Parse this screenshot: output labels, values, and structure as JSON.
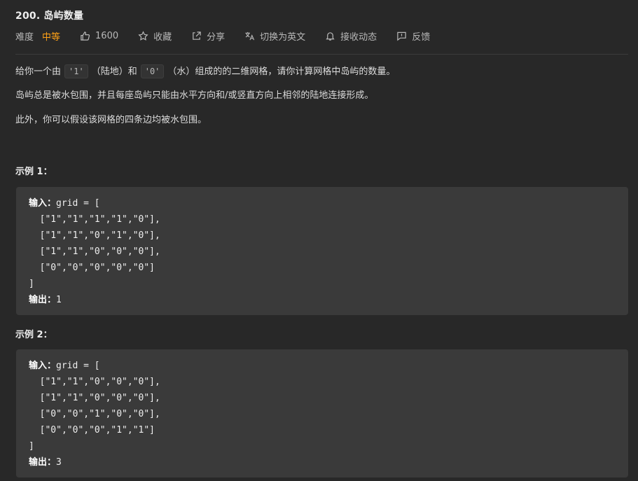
{
  "problem": {
    "title": "200. 岛屿数量",
    "difficulty_label": "难度",
    "difficulty_value": "中等",
    "likes": "1600",
    "favorite_label": "收藏",
    "share_label": "分享",
    "switch_lang_label": "切换为英文",
    "subscribe_label": "接收动态",
    "feedback_label": "反馈"
  },
  "description": {
    "p1_a": "给你一个由",
    "p1_code1": "'1'",
    "p1_b": "（陆地）和",
    "p1_code2": "'0'",
    "p1_c": "（水）组成的的二维网格，请你计算网格中岛屿的数量。",
    "p2": "岛屿总是被水包围，并且每座岛屿只能由水平方向和/或竖直方向上相邻的陆地连接形成。",
    "p3": "此外，你可以假设该网格的四条边均被水包围。"
  },
  "examples": [
    {
      "heading": "示例 1：",
      "input_label": "输入：",
      "input_first": "grid = [",
      "rows": [
        "  [\"1\",\"1\",\"1\",\"1\",\"0\"],",
        "  [\"1\",\"1\",\"0\",\"1\",\"0\"],",
        "  [\"1\",\"1\",\"0\",\"0\",\"0\"],",
        "  [\"0\",\"0\",\"0\",\"0\",\"0\"]"
      ],
      "input_close": "]",
      "output_label": "输出：",
      "output_value": "1"
    },
    {
      "heading": "示例 2：",
      "input_label": "输入：",
      "input_first": "grid = [",
      "rows": [
        "  [\"1\",\"1\",\"0\",\"0\",\"0\"],",
        "  [\"1\",\"1\",\"0\",\"0\",\"0\"],",
        "  [\"0\",\"0\",\"1\",\"0\",\"0\"],",
        "  [\"0\",\"0\",\"0\",\"1\",\"1\"]"
      ],
      "input_close": "]",
      "output_label": "输出：",
      "output_value": "3"
    }
  ],
  "colors": {
    "background": "#282828",
    "difficulty_medium": "#ffa116",
    "code_block_bg": "#3a3a3a"
  },
  "icons": [
    "thumbs-up-icon",
    "star-icon",
    "share-icon",
    "translate-icon",
    "bell-icon",
    "feedback-icon"
  ]
}
